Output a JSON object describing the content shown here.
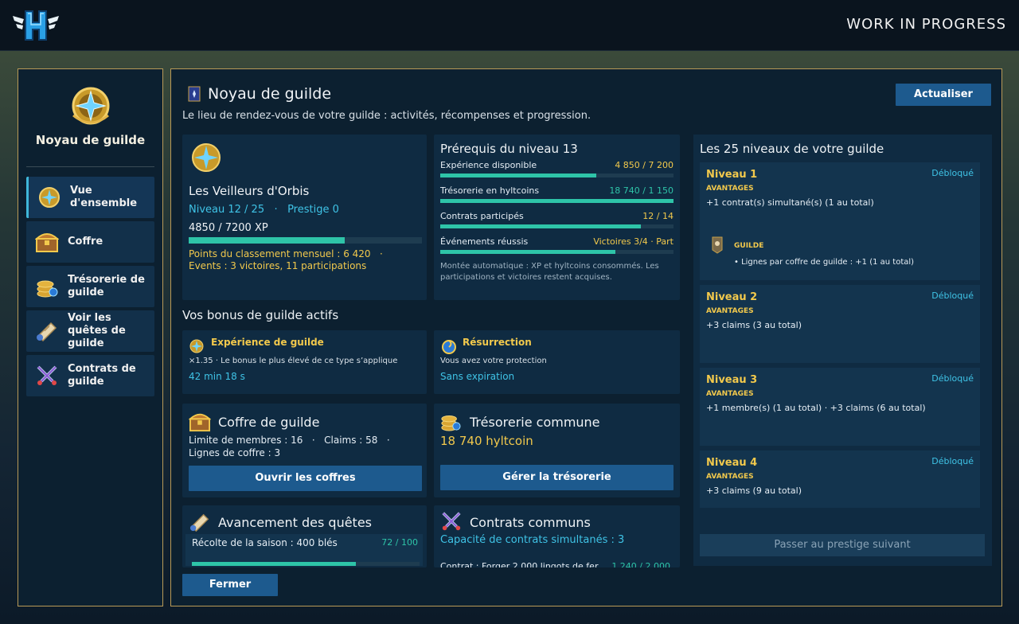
{
  "topbar": {
    "logo": "hyltonia-h-logo",
    "title": "WORK IN PROGRESS"
  },
  "sidebar": {
    "emblem": "guild-emblem-icon",
    "title": "Noyau de guilde",
    "items": [
      {
        "label": "Vue d'ensemble",
        "icon": "emblem-icon",
        "active": true
      },
      {
        "label": "Coffre",
        "icon": "chest-icon"
      },
      {
        "label": "Trésorerie de guilde",
        "icon": "coins-icon"
      },
      {
        "label": "Voir les quêtes de guilde",
        "icon": "scroll-icon"
      },
      {
        "label": "Contrats de guilde",
        "icon": "crossed-swords-icon"
      }
    ]
  },
  "main": {
    "title": "Noyau de guilde",
    "subtitle": "Le lieu de rendez-vous de votre guilde : activités, récompenses et progression.",
    "refresh_label": "Actualiser",
    "close_label": "Fermer"
  },
  "guild": {
    "name": "Les Veilleurs d'Orbis",
    "level": "Niveau 12 / 25",
    "prestige": "Prestige 0",
    "xp": "4850 / 7200 XP",
    "xp_progress": 0.67,
    "points": "Points du classement mensuel : 6 420",
    "events": "Events : 3 victoires, 11 participations"
  },
  "prereq": {
    "title": "Prérequis du niveau 13",
    "items": [
      {
        "label": "Expérience disponible",
        "value": "4 850 / 7 200",
        "progress": 0.67,
        "color": "#f2c94c"
      },
      {
        "label": "Trésorerie en hyltcoins",
        "value": "18 740 / 1 150",
        "progress": 1.0,
        "color": "#2ec4a8"
      },
      {
        "label": "Contrats participés",
        "value": "12 / 14",
        "progress": 0.86,
        "color": "#f2c94c"
      },
      {
        "label": "Événements réussis",
        "value": "Victoires 3/4 · Part",
        "progress": 0.75,
        "color": "#f2c94c"
      }
    ],
    "note": "Montée automatique : XP et hyltcoins consommés. Les participations et victoires restent acquises."
  },
  "bonuses": {
    "title": "Vos bonus de guilde actifs",
    "items": [
      {
        "name": "Expérience de guilde",
        "desc": "×1.35 · Le bonus le plus élevé de ce type s’applique",
        "time": "42 min 18 s"
      },
      {
        "name": "Résurrection",
        "desc": "Vous avez votre protection",
        "time": "Sans expiration"
      }
    ]
  },
  "chest": {
    "title": "Coffre de guilde",
    "members": "Limite de membres : 16",
    "claims": "Claims : 58",
    "lines": "Lignes de coffre : 3",
    "button": "Ouvrir les coffres"
  },
  "treasury": {
    "title": "Trésorerie commune",
    "amount": "18 740 hyltcoin",
    "button": "Gérer la trésorerie"
  },
  "quests": {
    "title": "Avancement des quêtes",
    "item": "Récolte de la saison : 400 blés",
    "value": "72 / 100",
    "progress": 0.72
  },
  "contracts": {
    "title": "Contrats communs",
    "capacity": "Capacité de contrats simultanés : 3",
    "item": "Contrat : Forger 2 000 lingots de fer",
    "value": "1 240 / 2 000"
  },
  "levels": {
    "title": "Les 25 niveaux de votre guilde",
    "items": [
      {
        "name": "Niveau 1",
        "status": "Débloqué",
        "adv": "AVANTAGES",
        "text": "+1 contrat(s) simultané(s) (1 au total)",
        "sub_title": "GUILDE",
        "sub_text": "• Lignes par coffre de guilde : +1 (1 au total)"
      },
      {
        "name": "Niveau 2",
        "status": "Débloqué",
        "adv": "AVANTAGES",
        "text": "+3 claims (3 au total)"
      },
      {
        "name": "Niveau 3",
        "status": "Débloqué",
        "adv": "AVANTAGES",
        "text": "+1 membre(s) (1 au total)  ·  +3 claims (6 au total)"
      },
      {
        "name": "Niveau 4",
        "status": "Débloqué",
        "adv": "AVANTAGES",
        "text": "+3 claims (9 au total)"
      }
    ],
    "prestige_button": "Passer au prestige suivant"
  },
  "colors": {
    "accent": "#1d5a8e",
    "gold": "#f2c94c",
    "cyan": "#3fc3e6",
    "teal": "#2ec4a8",
    "frame": "#b99a57"
  }
}
